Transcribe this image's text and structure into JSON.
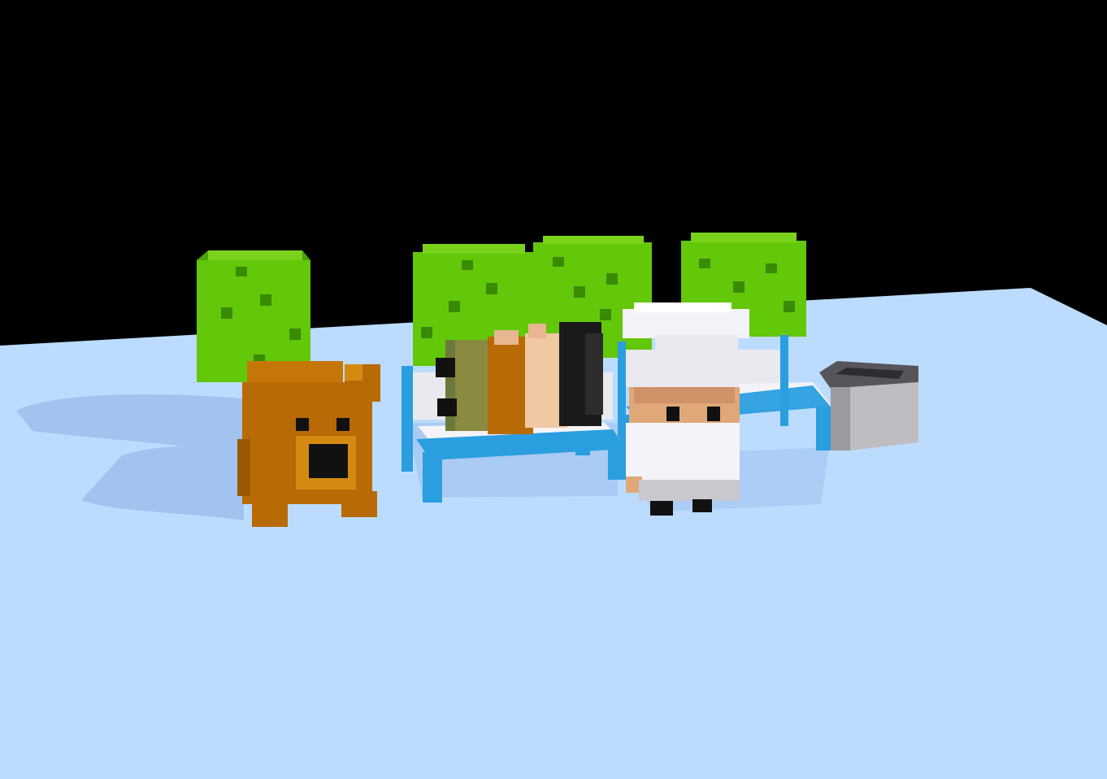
{
  "scene": {
    "type": "voxel-3d-viewport",
    "background_color": "#000000",
    "ground_color": "#bcdcff",
    "shadow_color": "#9fc0ec"
  },
  "objects": [
    {
      "name": "tree",
      "kind": "bush",
      "color": "#63c70a"
    },
    {
      "name": "tree",
      "kind": "bush",
      "color": "#63c70a"
    },
    {
      "name": "tree",
      "kind": "bush",
      "color": "#63c70a"
    },
    {
      "name": "tree",
      "kind": "bush",
      "color": "#63c70a"
    },
    {
      "name": "bear",
      "kind": "animal",
      "color": "#b86a06"
    },
    {
      "name": "bench",
      "kind": "furniture",
      "color": "#2b9ee0"
    },
    {
      "name": "bench",
      "kind": "furniture",
      "color": "#2b9ee0"
    },
    {
      "name": "sleeping-person",
      "kind": "character",
      "color": "#e8b690"
    },
    {
      "name": "chef",
      "kind": "character",
      "color": "#f4f4f8"
    },
    {
      "name": "trash-bin",
      "kind": "prop",
      "color": "#bdbdc2"
    }
  ]
}
